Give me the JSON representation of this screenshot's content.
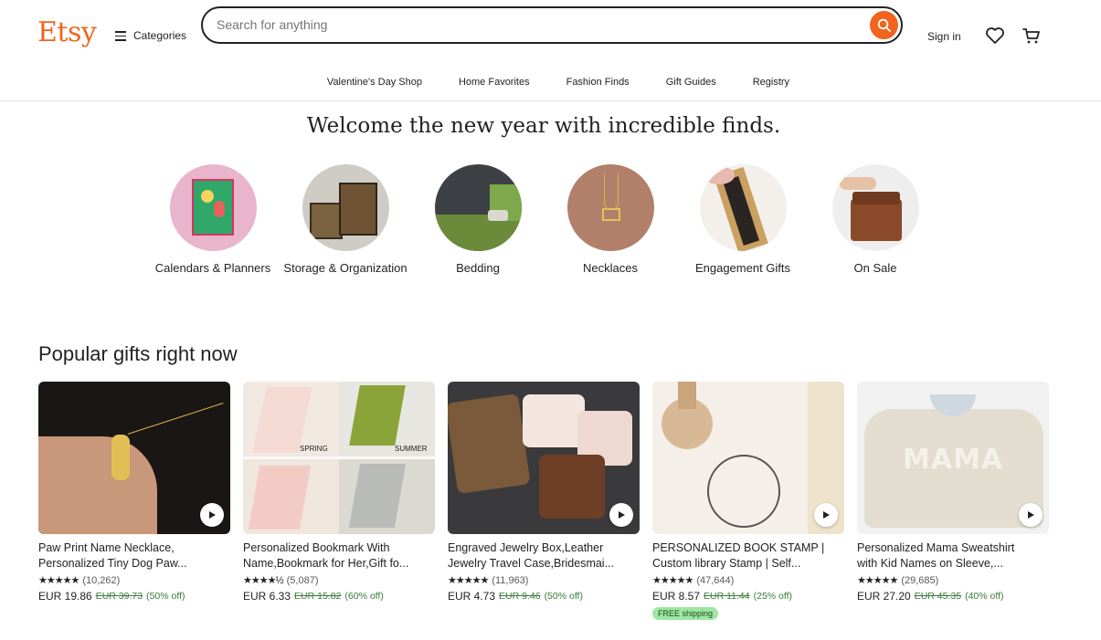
{
  "header": {
    "logo": "Etsy",
    "categories_label": "Categories",
    "search_placeholder": "Search for anything",
    "signin_label": "Sign in"
  },
  "nav": [
    "Valentine's Day Shop",
    "Home Favorites",
    "Fashion Finds",
    "Gift Guides",
    "Registry"
  ],
  "hero": {
    "title": "Welcome the new year with incredible finds."
  },
  "categories": [
    {
      "label": "Calendars & Planners"
    },
    {
      "label": "Storage & Organization"
    },
    {
      "label": "Bedding"
    },
    {
      "label": "Necklaces"
    },
    {
      "label": "Engagement Gifts"
    },
    {
      "label": "On Sale"
    }
  ],
  "popular": {
    "title": "Popular gifts right now",
    "items": [
      {
        "line1": "Paw Print Name Necklace,",
        "line2": "Personalized Tiny Dog Paw...",
        "reviews": "(10,262)",
        "price": "EUR 19.86",
        "old": "EUR 39.73",
        "off": "(50% off)"
      },
      {
        "line1": "Personalized Bookmark With",
        "line2": "Name,Bookmark for Her,Gift fo...",
        "reviews": "(5,087)",
        "price": "EUR 6.33",
        "old": "EUR 15.82",
        "off": "(60% off)",
        "img_labels": [
          "SPRING",
          "SUMMER"
        ]
      },
      {
        "line1": "Engraved Jewelry Box,Leather",
        "line2": "Jewelry Travel Case,Bridesmai...",
        "reviews": "(11,963)",
        "price": "EUR 4.73",
        "old": "EUR 9.46",
        "off": "(50% off)"
      },
      {
        "line1": "PERSONALIZED BOOK STAMP |",
        "line2": "Custom library Stamp | Self...",
        "reviews": "(47,644)",
        "price": "EUR 8.57",
        "old": "EUR 11.44",
        "off": "(25% off)",
        "badge": "FREE shipping"
      },
      {
        "line1": "Personalized Mama Sweatshirt",
        "line2": "with Kid Names on Sleeve,...",
        "reviews": "(29,685)",
        "price": "EUR 27.20",
        "old": "EUR 45.35",
        "off": "(40% off)",
        "img_text": "MAMA"
      }
    ]
  },
  "colors": {
    "brand": "#f1641e",
    "sale": "#3a7a3a",
    "badge": "#9ee6a2"
  },
  "icons": [
    "menu-icon",
    "search-icon",
    "heart-icon",
    "cart-icon",
    "play-icon",
    "star-icon"
  ]
}
